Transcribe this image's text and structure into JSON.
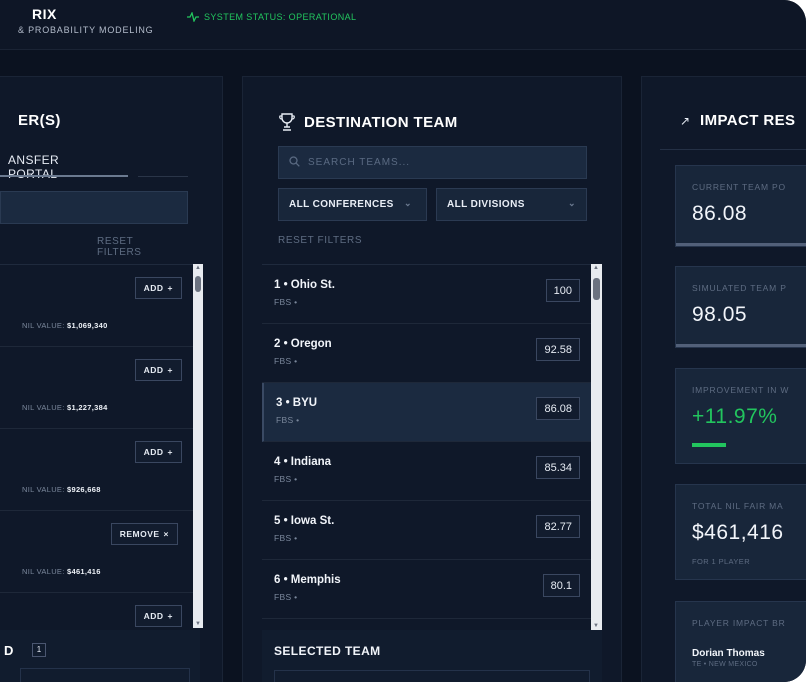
{
  "header": {
    "brand_title": "RIX",
    "brand_subtitle": "& PROBABILITY MODELING",
    "status_text": "SYSTEM STATUS: OPERATIONAL",
    "status_color": "#22c55e"
  },
  "left_panel": {
    "title": "ER(S)",
    "tab_active": "ANSFER PORTAL",
    "reset_filters": "RESET FILTERS",
    "nil_label": "NIL VALUE:",
    "players": [
      {
        "button": "ADD",
        "button_icon": "+",
        "nil_value": "$1,069,340"
      },
      {
        "button": "ADD",
        "button_icon": "+",
        "nil_value": "$1,227,384"
      },
      {
        "button": "ADD",
        "button_icon": "+",
        "nil_value": "$926,668"
      },
      {
        "button": "REMOVE",
        "button_icon": "×",
        "nil_value": "$461,416"
      },
      {
        "button": "ADD",
        "button_icon": "+",
        "nil_value": ""
      }
    ],
    "footer_label": "D",
    "footer_count": "1"
  },
  "middle_panel": {
    "title": "DESTINATION TEAM",
    "search_placeholder": "SEARCH TEAMS...",
    "conference_select": "ALL CONFERENCES",
    "division_select": "ALL DIVISIONS",
    "reset_filters": "RESET FILTERS",
    "teams": [
      {
        "name": "1 • Ohio St.",
        "sub": "FBS •",
        "score": "100"
      },
      {
        "name": "2 • Oregon",
        "sub": "FBS •",
        "score": "92.58"
      },
      {
        "name": "3 • BYU",
        "sub": "FBS •",
        "score": "86.08"
      },
      {
        "name": "4 • Indiana",
        "sub": "FBS •",
        "score": "85.34"
      },
      {
        "name": "5 • Iowa St.",
        "sub": "FBS •",
        "score": "82.77"
      },
      {
        "name": "6 • Memphis",
        "sub": "FBS •",
        "score": "80.1"
      }
    ],
    "selected_index": 2,
    "selected_team_label": "SELECTED TEAM"
  },
  "right_panel": {
    "title": "IMPACT RES",
    "cards": [
      {
        "label": "CURRENT TEAM PO",
        "value": "86.08"
      },
      {
        "label": "SIMULATED TEAM P",
        "value": "98.05"
      },
      {
        "label": "IMPROVEMENT IN W",
        "value": "+11.97%"
      },
      {
        "label": "TOTAL NIL FAIR MA",
        "value": "$461,416",
        "sub": "FOR 1 PLAYER"
      },
      {
        "label": "PLAYER IMPACT BR",
        "player_name": "Dorian Thomas",
        "player_pos": "TE • NEW MEXICO"
      }
    ],
    "improvement_color": "#22c55e"
  }
}
